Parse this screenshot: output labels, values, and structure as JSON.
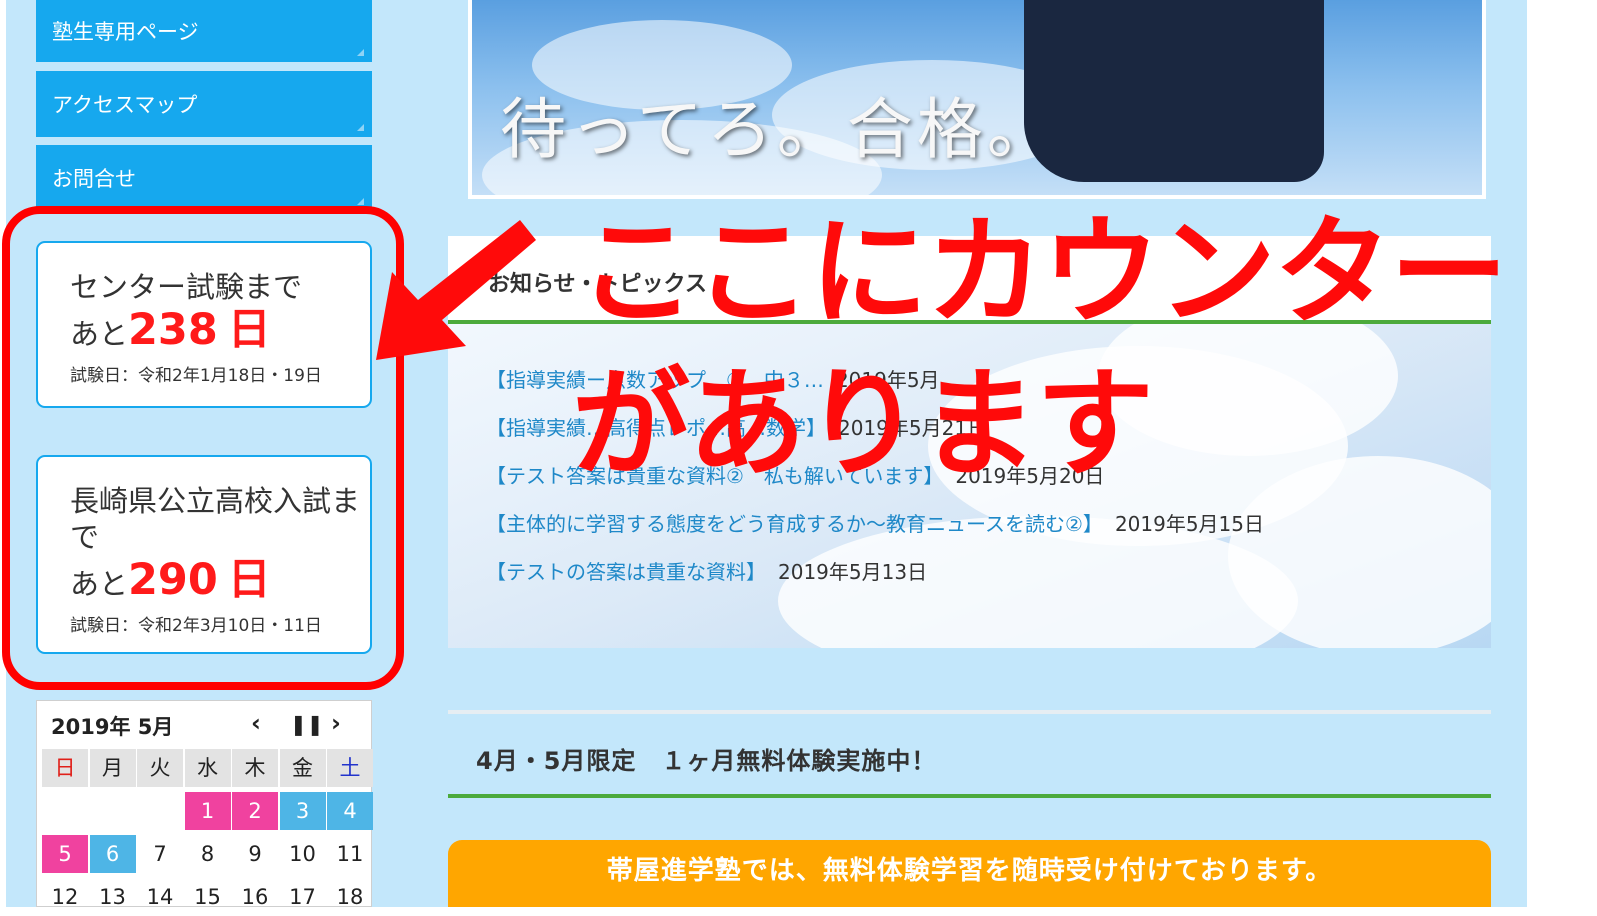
{
  "sidebar": {
    "nav": [
      {
        "label": "塾生専用ページ"
      },
      {
        "label": "アクセスマップ"
      },
      {
        "label": "お問合せ"
      }
    ]
  },
  "counters": [
    {
      "title": "センター試験まで",
      "prefix": "あと",
      "days": "238",
      "unit": "日",
      "exam_date": "試験日：令和2年1月18日・19日"
    },
    {
      "title": "長崎県公立高校入試まで",
      "prefix": "あと",
      "days": "290",
      "unit": "日",
      "exam_date": "試験日：令和2年3月10日・11日"
    }
  ],
  "calendar": {
    "title": "2019年 5月",
    "prev": "‹",
    "pause": "❚❚",
    "next": "›",
    "weekdays": [
      "日",
      "月",
      "火",
      "水",
      "木",
      "金",
      "土"
    ],
    "rows": [
      [
        "",
        "",
        "",
        "1",
        "2",
        "3",
        "4"
      ],
      [
        "5",
        "6",
        "7",
        "8",
        "9",
        "10",
        "11"
      ],
      [
        "12",
        "13",
        "14",
        "15",
        "16",
        "17",
        "18"
      ]
    ]
  },
  "hero": {
    "text": "待ってろ。合格。"
  },
  "news": {
    "title": "お知らせ・トピックス",
    "items": [
      {
        "link": "【指導実績ー点数アップ…①　中３…",
        "date": "2019年5月…"
      },
      {
        "link": "【指導実績…高得点レポ…高…数学】",
        "date": "2019年5月21日"
      },
      {
        "link": "【テスト答案は貴重な資料②　私も解いています】",
        "date": "2019年5月20日"
      },
      {
        "link": "【主体的に学習する態度をどう育成するか～教育ニュースを読む②】",
        "date": "2019年5月15日"
      },
      {
        "link": "【テストの答案は貴重な資料】",
        "date": "2019年5月13日"
      }
    ]
  },
  "campaign": {
    "title": "4月・5月限定　１ヶ月無料体験実施中！",
    "banner": "帯屋進学塾では、無料体験学習を随時受け付けております。"
  },
  "annotation": {
    "line1": "ここにカウンター",
    "line2": "があります",
    "color": "#ff0a0a"
  }
}
